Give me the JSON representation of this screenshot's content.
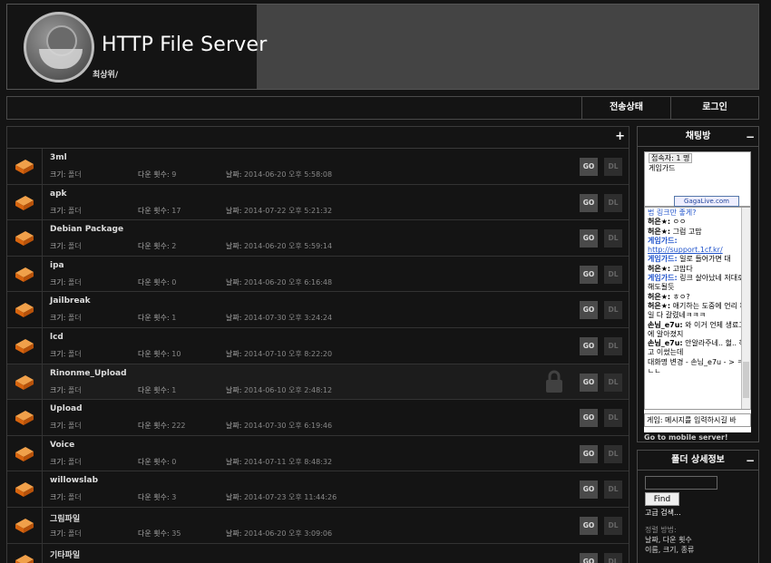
{
  "header": {
    "title": "HTTP File Server",
    "breadcrumb": "최상위/"
  },
  "nav": {
    "transfer": "전송상태",
    "login": "로그인"
  },
  "list": {
    "add": "+",
    "size_label": "크기:",
    "downloads_label": "다운 횟수:",
    "date_label": "날짜:",
    "go_label": "GO",
    "dl_label": "DL",
    "rows": [
      {
        "name": "3ml",
        "size": "폴더",
        "downloads": "9",
        "date": "2014-06-20 오후 5:58:08"
      },
      {
        "name": "apk",
        "size": "폴더",
        "downloads": "17",
        "date": "2014-07-22 오후 5:21:32"
      },
      {
        "name": "Debian Package",
        "size": "폴더",
        "downloads": "2",
        "date": "2014-06-20 오후 5:59:14"
      },
      {
        "name": "ipa",
        "size": "폴더",
        "downloads": "0",
        "date": "2014-06-20 오후 6:16:48"
      },
      {
        "name": "Jailbreak",
        "size": "폴더",
        "downloads": "1",
        "date": "2014-07-30 오후 3:24:24"
      },
      {
        "name": "lcd",
        "size": "폴더",
        "downloads": "10",
        "date": "2014-07-10 오후 8:22:20"
      },
      {
        "name": "Rinonme_Upload",
        "size": "폴더",
        "downloads": "1",
        "date": "2014-06-10 오후 2:48:12"
      },
      {
        "name": "Upload",
        "size": "폴더",
        "downloads": "222",
        "date": "2014-07-30 오후 6:19:46"
      },
      {
        "name": "Voice",
        "size": "폴더",
        "downloads": "0",
        "date": "2014-07-11 오후 8:48:32"
      },
      {
        "name": "willowslab",
        "size": "폴더",
        "downloads": "3",
        "date": "2014-07-23 오후 11:44:26"
      },
      {
        "name": "그림파일",
        "size": "폴더",
        "downloads": "35",
        "date": "2014-06-20 오후 3:09:06"
      },
      {
        "name": "기타파일",
        "size": "",
        "downloads": "",
        "date": ""
      }
    ]
  },
  "chat": {
    "title": "채팅방",
    "collapse": "−",
    "connected": "접속자: 1 명",
    "guide": "게임가드",
    "gagalive": "GagaLive.com",
    "mobile": "Go to mobile server!",
    "input_value": "게임: 메시지를 입력하시길 바",
    "log": [
      {
        "who": "",
        "text": "법 링크만 좋게?",
        "style": "t"
      },
      {
        "who": "허은★:",
        "text": " ㅇㅇ",
        "style": "b"
      },
      {
        "who": "허은★:",
        "text": " 그럼 고맙",
        "style": "b"
      },
      {
        "who": "게임가드:",
        "text": "",
        "style": "g"
      },
      {
        "who": "",
        "text": "http://support.1cf.kr/",
        "style": "lk"
      },
      {
        "who": "게임가드:",
        "text": " 일로 들어가면 대",
        "style": "g"
      },
      {
        "who": "허은★:",
        "text": " 고맙다",
        "style": "b"
      },
      {
        "who": "게임가드:",
        "text": " 링크 살아났네 저대로해도될듯",
        "style": "g"
      },
      {
        "who": "허은★:",
        "text": " ㅎㅇ?",
        "style": "b"
      },
      {
        "who": "허은★:",
        "text": " 애기하는 도중에 언리 파일 다 갈렸네ㅋㅋㅋ",
        "style": "b"
      },
      {
        "who": "손님_e7u:",
        "text": " 와 이거 언제 생료고에 알아졌지",
        "style": "b"
      },
      {
        "who": "손님_e7u:",
        "text": " 안알라주네.. 헐.. 하고 이썼는데",
        "style": "b"
      },
      {
        "who": "",
        "text": "대화명 변경 - 손님_e7u - > ㅋㄴㄴ",
        "style": "n"
      }
    ]
  },
  "search": {
    "title": "폴더 상세정보",
    "collapse": "−",
    "find": "Find",
    "advanced": "고급 검색...",
    "sort_label": "정렬 방법:",
    "sort_line1": "날짜, 다운 횟수",
    "sort_line2": "이름, 크기, 종류"
  },
  "colors": {
    "accent": "#e8731a",
    "background": "#141414",
    "header_gray": "#444444"
  }
}
